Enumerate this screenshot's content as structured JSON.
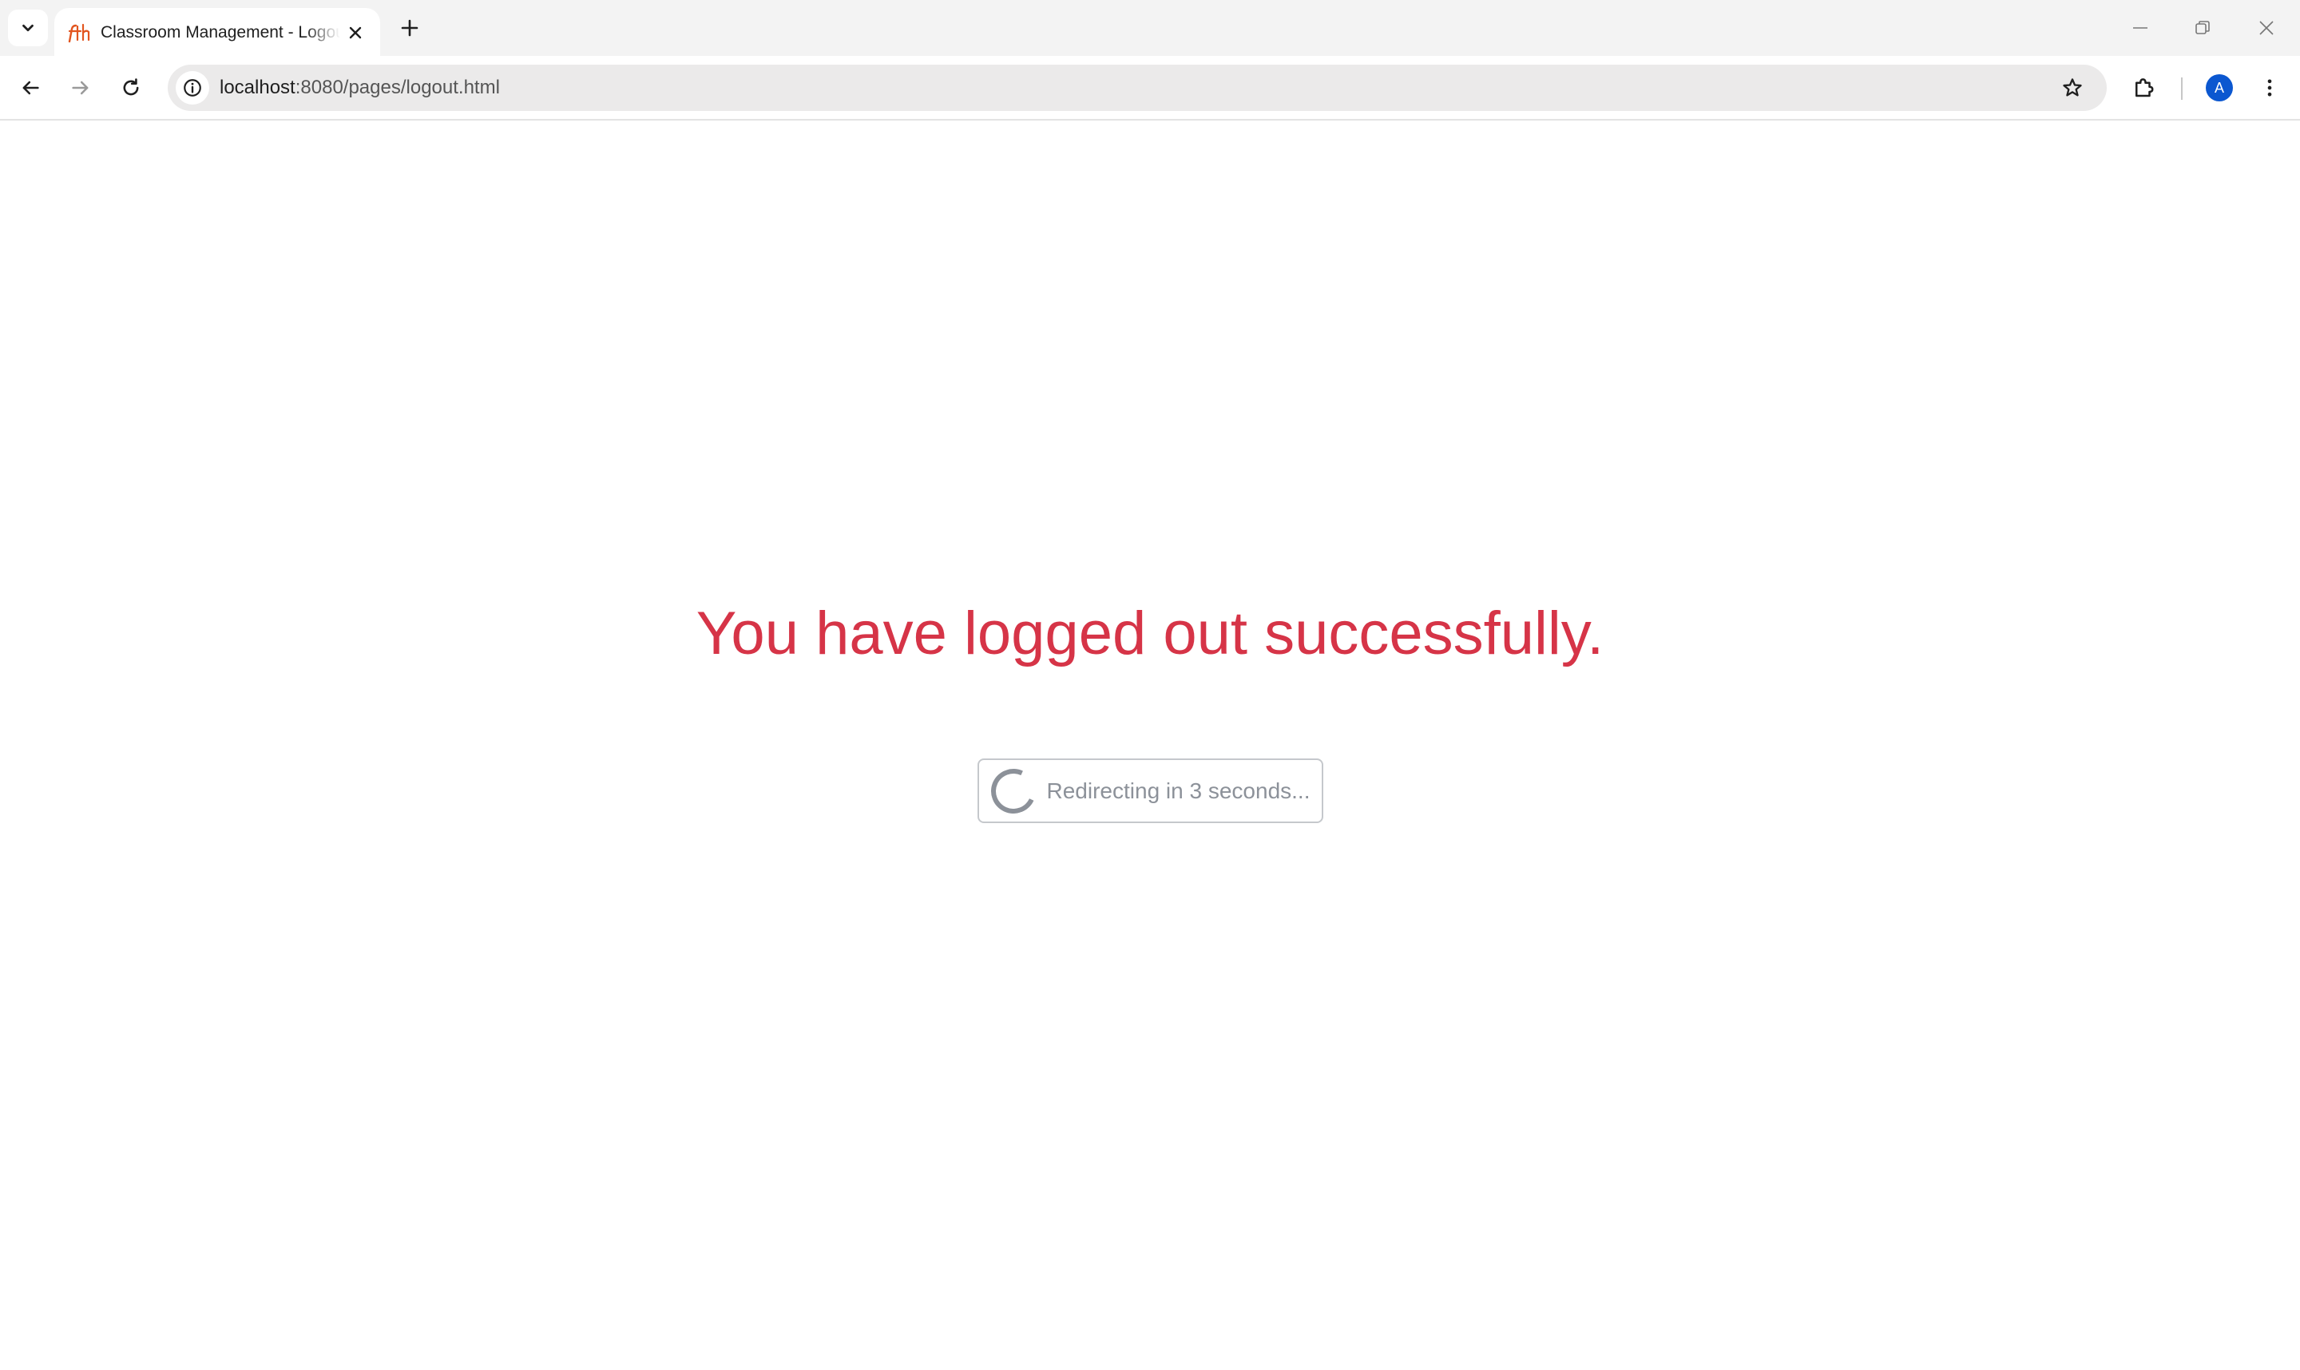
{
  "browser": {
    "tab": {
      "title": "Classroom Management - Logout",
      "favicon_text": "fth"
    },
    "address_bar": {
      "host": "localhost",
      "rest": ":8080/pages/logout.html"
    },
    "profile_initial": "A"
  },
  "page": {
    "heading": "You have logged out successfully.",
    "redirect_label": "Redirecting in 3 seconds..."
  },
  "colors": {
    "heading": "#d63447",
    "favicon": "#e2551f",
    "avatar": "#0b57d0",
    "muted": "#8c9199"
  },
  "icons": {
    "tab_search": "chevron-down-icon",
    "tab_close": "close-icon",
    "new_tab": "plus-icon",
    "back": "arrow-left-icon",
    "forward": "arrow-right-icon",
    "reload": "reload-icon",
    "site_info": "info-icon",
    "bookmark": "star-icon",
    "extensions": "puzzle-icon",
    "menu": "kebab-menu-icon",
    "spinner": "spinner-icon"
  }
}
